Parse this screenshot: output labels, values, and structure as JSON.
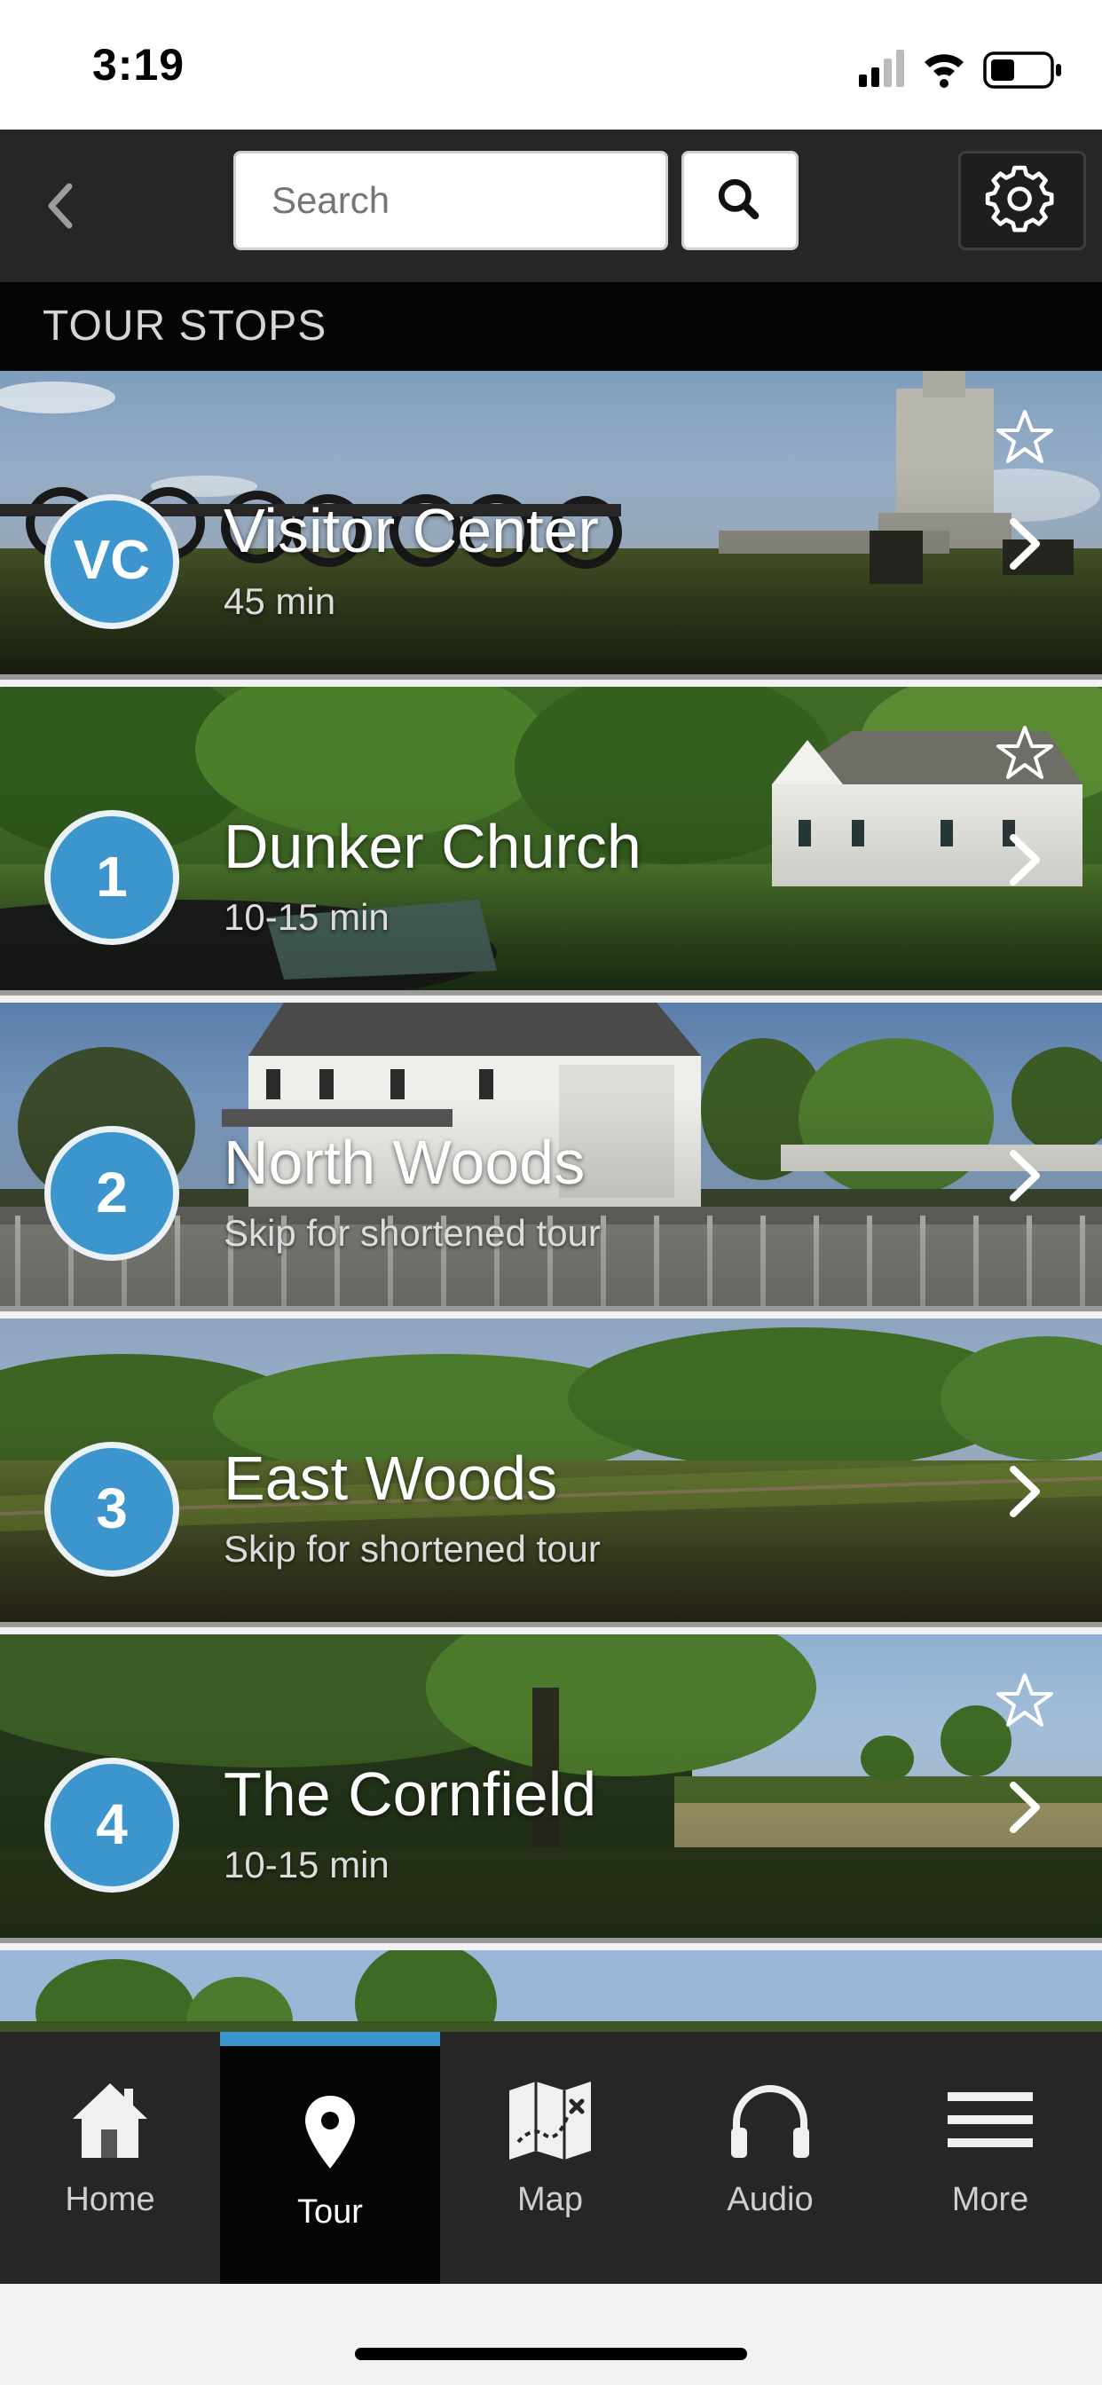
{
  "status_bar": {
    "time": "3:19"
  },
  "header": {
    "back_icon": "chevron-left-icon",
    "search": {
      "placeholder": "Search",
      "value": ""
    },
    "search_icon": "search-icon",
    "settings_icon": "gear-icon"
  },
  "section": {
    "title": "TOUR STOPS"
  },
  "stops": [
    {
      "badge": "VC",
      "title": "Visitor Center",
      "subtitle": "45 min",
      "favorite_icon": "star-outline-icon"
    },
    {
      "badge": "1",
      "title": "Dunker Church",
      "subtitle": "10-15 min",
      "favorite_icon": "star-outline-icon"
    },
    {
      "badge": "2",
      "title": "North Woods",
      "subtitle": "Skip for shortened tour"
    },
    {
      "badge": "3",
      "title": "East Woods",
      "subtitle": "Skip for shortened tour"
    },
    {
      "badge": "4",
      "title": "The Cornfield",
      "subtitle": "10-15 min",
      "favorite_icon": "star-outline-icon"
    }
  ],
  "tab_bar": {
    "active": "Tour",
    "tabs": [
      {
        "label": "Home",
        "icon": "home-icon"
      },
      {
        "label": "Tour",
        "icon": "map-pin-icon"
      },
      {
        "label": "Map",
        "icon": "folded-map-icon"
      },
      {
        "label": "Audio",
        "icon": "headphones-icon"
      },
      {
        "label": "More",
        "icon": "menu-icon"
      }
    ]
  },
  "colors": {
    "accent": "#3d95cd",
    "header_bg": "#262626",
    "section_bg": "#050505",
    "tab_bar_bg": "#262626"
  }
}
